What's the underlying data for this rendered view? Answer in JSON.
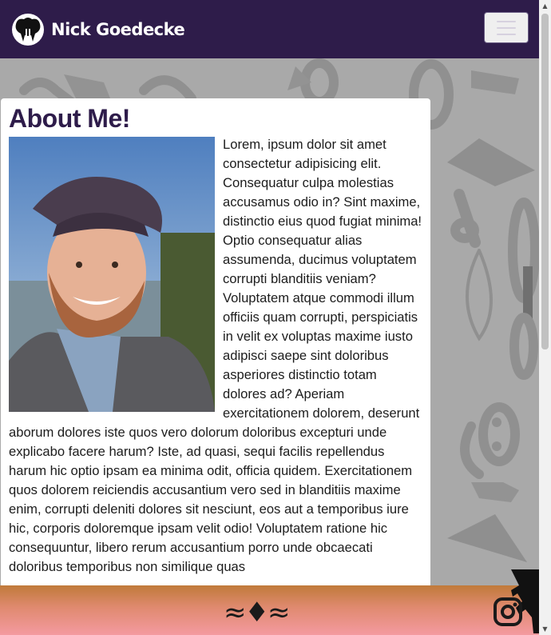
{
  "navbar": {
    "brand_name": "Nick Goedecke",
    "logo_icon": "elephant-logo-icon",
    "menu_icon": "hamburger-menu-icon",
    "background": "#2e1c4a"
  },
  "about": {
    "title": "About Me!",
    "photo_alt": "portrait photo",
    "bio": "Lorem, ipsum dolor sit amet consectetur adipisicing elit. Consequatur culpa molestias accusamus odio in? Sint maxime, distinctio eius quod fugiat minima! Optio consequatur alias assumenda, ducimus voluptatem corrupti blanditiis veniam? Voluptatem atque commodi illum officiis quam corrupti, perspiciatis in velit ex voluptas maxime iusto adipisci saepe sint doloribus asperiores distinctio totam dolores ad? Aperiam exercitationem dolorem, deserunt aborum dolores iste quos vero dolorum doloribus excepturi unde explicabo facere harum? Iste, ad quasi, sequi facilis repellendus harum hic optio ipsam ea minima odit, officia quidem. Exercitationem quos dolorem reiciendis accusantium vero sed in blanditiis maxime enim, corrupti deleniti dolores sit nesciunt, eos aut a temporibus iure hic, corporis doloremque ipsam velit odio! Voluptatem ratione hic consequuntur, libero rerum accusantium porro unde obcaecati doloribus temporibus non similique quas"
  },
  "footer": {
    "mark": "≈♦≈",
    "instagram_icon": "instagram-icon",
    "climber_icon": "climber-silhouette-icon"
  },
  "colors": {
    "brand": "#2e1c4a",
    "footer_top": "#c07a3a",
    "footer_bottom": "#f49aa0"
  }
}
